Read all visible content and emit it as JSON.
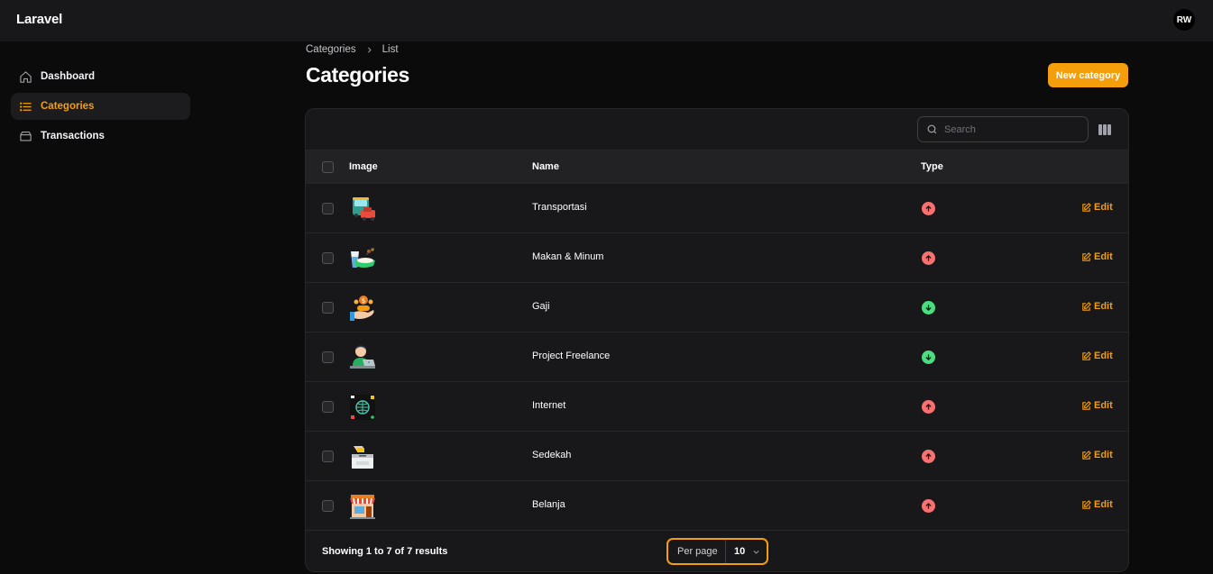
{
  "app": {
    "brand": "Laravel",
    "user_initials": "RW"
  },
  "sidebar": {
    "items": [
      {
        "label": "Dashboard",
        "icon": "home-icon",
        "active": false
      },
      {
        "label": "Categories",
        "icon": "list-icon",
        "active": true
      },
      {
        "label": "Transactions",
        "icon": "inbox-icon",
        "active": false
      }
    ]
  },
  "breadcrumb": {
    "parent": "Categories",
    "current": "List"
  },
  "page": {
    "title": "Categories",
    "new_button": "New category"
  },
  "table": {
    "search_placeholder": "Search",
    "columns": {
      "image": "Image",
      "name": "Name",
      "type": "Type"
    },
    "edit_label": "Edit",
    "rows": [
      {
        "name": "Transportasi",
        "type": "expense",
        "image_icon": "bus-car-icon"
      },
      {
        "name": "Makan & Minum",
        "type": "expense",
        "image_icon": "food-drink-icon"
      },
      {
        "name": "Gaji",
        "type": "income",
        "image_icon": "salary-money-hand-icon"
      },
      {
        "name": "Project Freelance",
        "type": "income",
        "image_icon": "freelancer-laptop-icon"
      },
      {
        "name": "Internet",
        "type": "expense",
        "image_icon": "internet-globe-icon"
      },
      {
        "name": "Sedekah",
        "type": "expense",
        "image_icon": "donation-box-icon"
      },
      {
        "name": "Belanja",
        "type": "expense",
        "image_icon": "shop-store-icon"
      }
    ],
    "footer": {
      "showing": "Showing 1 to 7 of 7 results",
      "per_page_label": "Per page",
      "per_page_value": "10"
    }
  },
  "colors": {
    "accent": "#f59e0b",
    "expense": "#f87171",
    "income": "#4ade80",
    "background": "#0b0b0c",
    "panel": "#18181b"
  }
}
